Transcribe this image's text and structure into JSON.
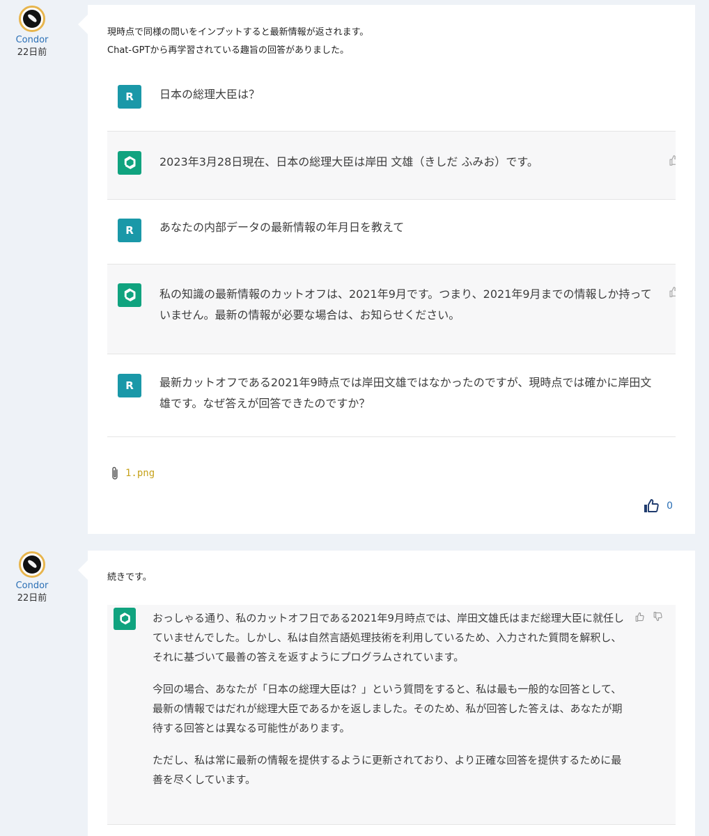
{
  "posts": [
    {
      "author": "Condor",
      "time": "22日前",
      "intro_lines": [
        "現時点で同様の問いをインプットすると最新情報が返されます。",
        "Chat-GPTから再学習されている趣旨の回答がありました。"
      ],
      "messages": [
        {
          "role": "user",
          "icon": "R",
          "text": "日本の総理大臣は？"
        },
        {
          "role": "assistant",
          "icon": "openai-logo-icon",
          "text": "2023年3月28日現在、日本の総理大臣は岸田 文雄（きしだ ふみお）です。"
        },
        {
          "role": "user",
          "icon": "R",
          "text": "あなたの内部データの最新情報の年月日を教えて"
        },
        {
          "role": "assistant",
          "icon": "openai-logo-icon",
          "text": "私の知識の最新情報のカットオフは、2021年9月です。つまり、2021年9月までの情報しか持っていません。最新の情報が必要な場合は、お知らせください。"
        },
        {
          "role": "user",
          "icon": "R",
          "text": "最新カットオフである2021年9時点では岸田文雄ではなかったのですが、現時点では確かに岸田文雄です。なぜ答えが回答できたのですか？"
        }
      ],
      "attachment": "1.png",
      "like_count": "0"
    },
    {
      "author": "Condor",
      "time": "22日前",
      "intro_lines": [
        "続きです。"
      ],
      "messages": [
        {
          "role": "assistant",
          "icon": "openai-logo-icon",
          "paragraphs": [
            "おっしゃる通り、私のカットオフ日である2021年9月時点では、岸田文雄氏はまだ総理大臣に就任していませんでした。しかし、私は自然言語処理技術を利用しているため、入力された質問を解釈し、それに基づいて最善の答えを返すようにプログラムされています。",
            "今回の場合、あなたが「日本の総理大臣は？」という質問をすると、私は最も一般的な回答として、最新の情報ではだれが総理大臣であるかを返しました。そのため、私が回答した答えは、あなたが期待する回答とは異なる可能性があります。",
            "ただし、私は常に最新の情報を提供するように更新されており、より正確な回答を提供するために最善を尽くしています。"
          ]
        }
      ]
    }
  ],
  "colors": {
    "background": "#eef2f7",
    "card": "#ffffff",
    "author_link": "#2a6fb5",
    "avatar_ring": "#e7b54d",
    "user_icon": "#1a98a8",
    "gpt_icon": "#10a37f",
    "assistant_bg": "#f7f7f8",
    "attachment_link": "#c6a21b"
  }
}
